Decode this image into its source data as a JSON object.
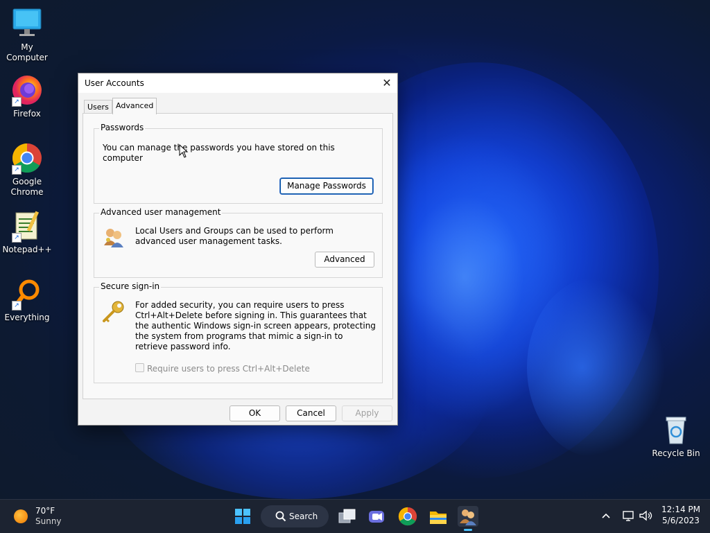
{
  "desktop": {
    "icons": [
      {
        "label": "My Computer",
        "icon": "monitor-icon"
      },
      {
        "label": "Firefox",
        "icon": "firefox-icon"
      },
      {
        "label": "Google\nChrome",
        "icon": "chrome-icon"
      },
      {
        "label": "Notepad++",
        "icon": "notepadpp-icon"
      },
      {
        "label": "Everything",
        "icon": "everything-icon"
      },
      {
        "label": "Recycle Bin",
        "icon": "recycle-bin-icon"
      }
    ]
  },
  "dialog": {
    "title": "User Accounts",
    "close_glyph": "✕",
    "tabs": [
      {
        "label": "Users",
        "selected": false
      },
      {
        "label": "Advanced",
        "selected": true
      }
    ],
    "passwords": {
      "label": "Passwords",
      "text": "You can manage the passwords you have stored on this computer",
      "button": "Manage Passwords"
    },
    "advanced_mgmt": {
      "label": "Advanced user management",
      "text": "Local Users and Groups can be used to perform advanced user management tasks.",
      "button": "Advanced"
    },
    "secure_signin": {
      "label": "Secure sign-in",
      "text": "For added security, you can require users to press Ctrl+Alt+Delete before signing in. This guarantees that the authentic Windows sign-in screen appears, protecting the system from programs that mimic a sign-in to retrieve password info.",
      "checkbox_label": "Require users to press Ctrl+Alt+Delete",
      "checkbox_checked": false,
      "checkbox_enabled": false
    },
    "buttons": {
      "ok": "OK",
      "cancel": "Cancel",
      "apply": "Apply"
    }
  },
  "taskbar": {
    "weather": {
      "temp": "70°F",
      "condition": "Sunny"
    },
    "search_label": "Search",
    "apps": [
      "start-icon",
      "search-icon",
      "task-view-icon",
      "meet-icon",
      "chrome-icon",
      "file-explorer-icon",
      "user-accounts-icon"
    ],
    "clock": {
      "time": "12:14 PM",
      "date": "5/6/2023"
    }
  },
  "colors": {
    "accent": "#0067c0",
    "taskbar": "#1c2331",
    "dialog_bg": "#f3f3f3"
  }
}
